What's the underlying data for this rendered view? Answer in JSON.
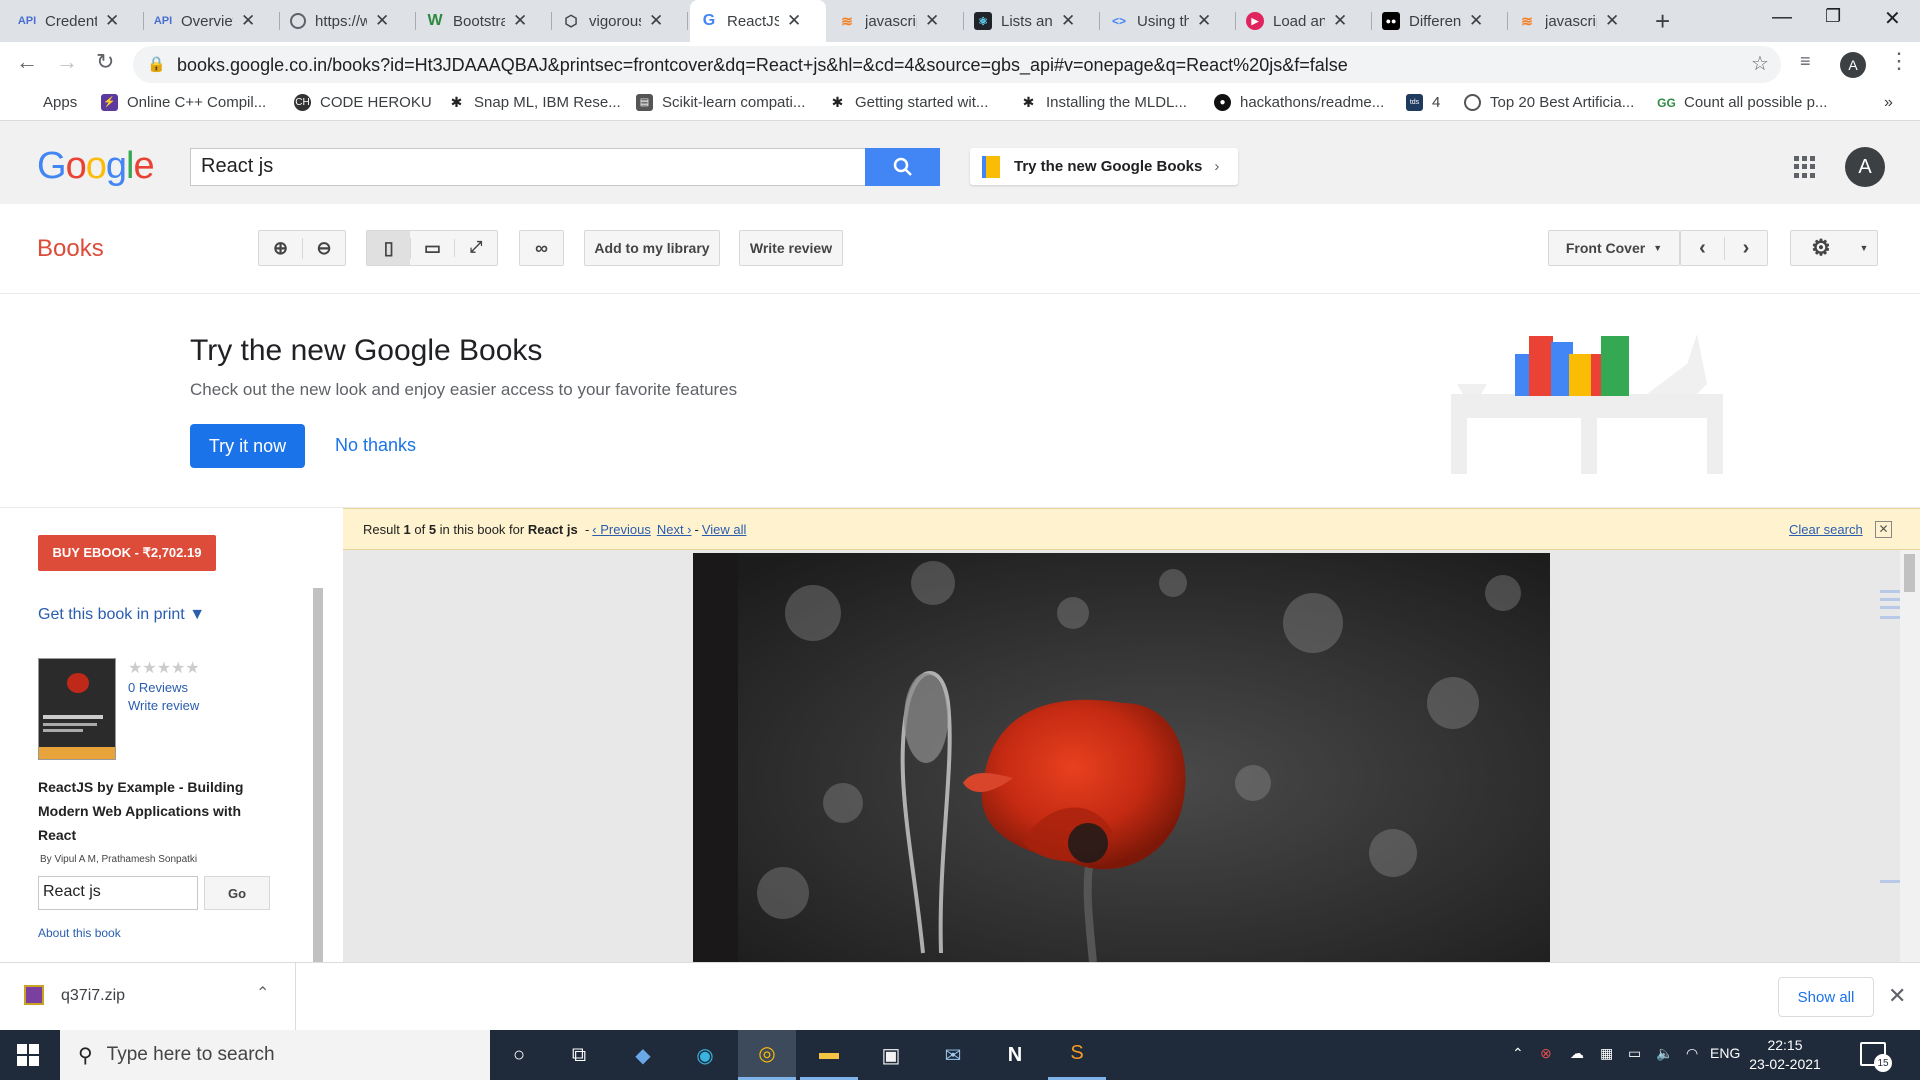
{
  "browser": {
    "tabs": [
      {
        "title": "Credentials",
        "icon": "api-icon"
      },
      {
        "title": "Overview",
        "icon": "api-icon"
      },
      {
        "title": "https://www",
        "icon": "globe-icon"
      },
      {
        "title": "Bootstrap",
        "icon": "w-icon"
      },
      {
        "title": "vigorous",
        "icon": "codesandbox-icon"
      },
      {
        "title": "ReactJS",
        "icon": "google-icon"
      },
      {
        "title": "javascript",
        "icon": "stackoverflow-icon"
      },
      {
        "title": "Lists and",
        "icon": "react-icon"
      },
      {
        "title": "Using th",
        "icon": "code-icon"
      },
      {
        "title": "Load an",
        "icon": "youtube-icon"
      },
      {
        "title": "Different",
        "icon": "medium-icon"
      },
      {
        "title": "javascript",
        "icon": "stackoverflow-icon"
      }
    ],
    "url": "books.google.co.in/books?id=Ht3JDAAAQBAJ&printsec=frontcover&dq=React+js&hl=&cd=4&source=gbs_api#v=onepage&q=React%20js&f=false",
    "profile_initial": "A",
    "bookmarks": [
      {
        "label": "Apps",
        "icon": "apps-icon",
        "color": "#4285f4"
      },
      {
        "label": "Online C++ Compil...",
        "icon": "bolt-icon",
        "color": "#5b3a9e"
      },
      {
        "label": "CODE HEROKU",
        "icon": "ch-icon",
        "color": "#333333"
      },
      {
        "label": "Snap ML, IBM Rese...",
        "icon": "bee-icon",
        "color": "#222222"
      },
      {
        "label": "Scikit-learn compati...",
        "icon": "book-icon",
        "color": "#555555"
      },
      {
        "label": "Getting started wit...",
        "icon": "bee-icon",
        "color": "#222222"
      },
      {
        "label": "Installing the MLDL...",
        "icon": "bee-icon",
        "color": "#222222"
      },
      {
        "label": "hackathons/readme...",
        "icon": "github-icon",
        "color": "#111111"
      },
      {
        "label": "4",
        "icon": "tds-icon",
        "color": "#1e3a5f"
      },
      {
        "label": "Top 20 Best Artificia...",
        "icon": "compass-icon",
        "color": "#555555"
      },
      {
        "label": "Count all possible p...",
        "icon": "gfg-icon",
        "color": "#2f8d46"
      }
    ]
  },
  "google_header": {
    "logo": "Google",
    "search_value": "React js",
    "try_new": "Try the new Google Books",
    "account_initial": "A"
  },
  "books_bar": {
    "title": "Books",
    "add_library": "Add to my library",
    "write_review": "Write review",
    "front_cover": "Front Cover"
  },
  "banner": {
    "title": "Try the new Google Books",
    "subtitle": "Check out the new look and enjoy easier access to your favorite features",
    "try_now": "Try it now",
    "no_thanks": "No thanks"
  },
  "sidebar": {
    "buy": "BUY EBOOK - ₹2,702.19",
    "get_print": "Get this book in print ▼",
    "stars": "★★★★★",
    "reviews": "0 Reviews",
    "write_review": "Write review",
    "book_title": "ReactJS by Example - Building Modern Web Applications with React",
    "authors": "By Vipul A M, Prathamesh Sonpatki",
    "inbook_search": "React js",
    "go": "Go",
    "about": "About this book"
  },
  "result_bar": {
    "result_label": "Result",
    "current": "1",
    "of_label": "of",
    "total": "5",
    "in_book": "in this book for",
    "query": "React js",
    "dash": "-",
    "previous": "‹ Previous",
    "next": "Next ›",
    "view_all": "View all",
    "clear": "Clear search"
  },
  "downloads": {
    "file": "q37i7.zip",
    "show_all": "Show all"
  },
  "taskbar": {
    "search_placeholder": "Type here to search",
    "language": "ENG",
    "time": "22:15",
    "date": "23-02-2021",
    "notifications": "15"
  },
  "colors": {
    "brand_red": "#dd4b39",
    "link_blue": "#2a5db0",
    "google_blue": "#4285f4",
    "taskbar": "#1f2b3a"
  }
}
